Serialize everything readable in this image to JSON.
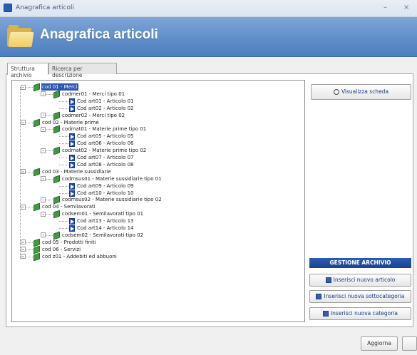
{
  "window": {
    "title": "Anagrafica articoli",
    "controls": [
      "–",
      "×"
    ]
  },
  "header": {
    "title": "Anagrafica articoli"
  },
  "tabs": [
    {
      "label": "Struttura archivio",
      "active": true
    },
    {
      "label": "Ricerca per descrizione",
      "active": false
    }
  ],
  "tree": {
    "nodes": [
      {
        "label": "cod 01 - Merci",
        "icon": "green-cube-icon",
        "selected": true
      },
      {
        "label": "codmer01 - Merci tipo 01",
        "icon": "green-cube-icon"
      },
      {
        "label": "Cod art01 - Articolo 01",
        "icon": "blue-item-icon"
      },
      {
        "label": "Cod art02 - Articolo 02",
        "icon": "blue-item-icon"
      },
      {
        "label": "codmer02 - Merci tipo 02",
        "icon": "green-cube-icon"
      },
      {
        "label": "cod 02 - Materie prime",
        "icon": "green-cube-icon"
      },
      {
        "label": "codmat01 - Materie prime tipo 01",
        "icon": "green-cube-icon"
      },
      {
        "label": "Cod art05 - Articolo 05",
        "icon": "blue-item-icon"
      },
      {
        "label": "Cod art06 - Articolo 06",
        "icon": "blue-item-icon"
      },
      {
        "label": "codmat02 - Materie prime tipo 02",
        "icon": "green-cube-icon"
      },
      {
        "label": "Cod art07 - Articolo 07",
        "icon": "blue-item-icon"
      },
      {
        "label": "Cod art08 - Articolo 08",
        "icon": "blue-item-icon"
      },
      {
        "label": "cod 03 - Materie sussidiarie",
        "icon": "green-cube-icon"
      },
      {
        "label": "codmsus01 - Materie sussidiarie tipo 01",
        "icon": "green-cube-icon"
      },
      {
        "label": "Cod art09 - Articolo 09",
        "icon": "blue-item-icon"
      },
      {
        "label": "Cod art10 - Articolo 10",
        "icon": "blue-item-icon"
      },
      {
        "label": "codmsus02 - Materie sussidiarie tipo 02",
        "icon": "green-cube-icon"
      },
      {
        "label": "cod 04 - Semilavorati",
        "icon": "green-cube-icon"
      },
      {
        "label": "codsem01 - Semilavorati tipo 01",
        "icon": "green-cube-icon"
      },
      {
        "label": "Cod art13 - Articolo 13",
        "icon": "blue-item-icon"
      },
      {
        "label": "Cod art14 - Articolo 14",
        "icon": "blue-item-icon"
      },
      {
        "label": "codsem02 - Semilavorati tipo 02",
        "icon": "green-cube-icon"
      },
      {
        "label": "cod 05 - Prodotti finiti",
        "icon": "green-cube-icon"
      },
      {
        "label": "cod 06 - Servizi",
        "icon": "green-cube-icon"
      },
      {
        "label": "cod z01 - Addebiti ed abbuoni",
        "icon": "green-cube-icon"
      }
    ]
  },
  "buttons": {
    "visualizza": "Visualizza scheda",
    "gestione_header": "GESTIONE ARCHIVIO",
    "nuovo_articolo": "Inserisci nuovo articolo",
    "nuova_sottocategoria": "Inserisci nuova sottocategoria",
    "nuova_categoria": "Inserisci nuova categoria",
    "aggiorna": "Aggiorna"
  },
  "colors": {
    "header": "#5f8ec9",
    "selection": "#2a55b8",
    "gestione": "#1c428c"
  }
}
